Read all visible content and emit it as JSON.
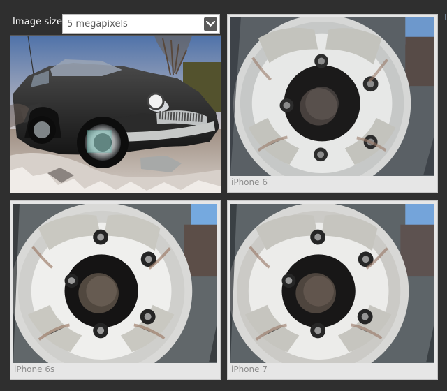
{
  "controls": {
    "image_size_label": "Image size:",
    "image_size_value": "5 megapixels",
    "edge_label": "i"
  },
  "icons": {
    "dropdown": "chevron-down-icon",
    "crop": "crop-selector-icon"
  },
  "preview": {
    "name": "car-preview-image"
  },
  "cards": [
    {
      "caption": "iPhone 6"
    },
    {
      "caption": "iPhone 6s"
    },
    {
      "caption": "iPhone 7"
    }
  ],
  "colors": {
    "background": "#2f2f2f",
    "card": "#e6e6e6",
    "caption": "#8d8d8d",
    "select": "#ffffff",
    "dropdown_button": "#5a5a5a"
  }
}
